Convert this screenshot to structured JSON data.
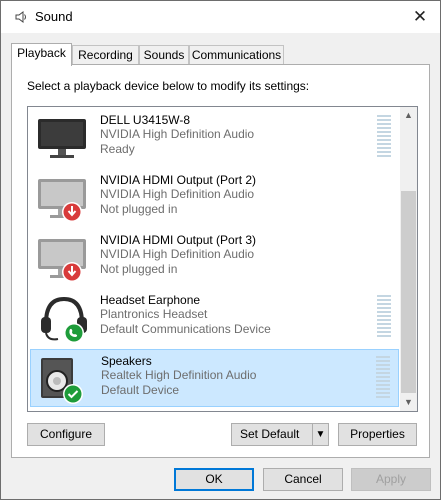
{
  "window": {
    "title": "Sound",
    "close_glyph": "✕"
  },
  "tabs": [
    {
      "label": "Playback",
      "active": true
    },
    {
      "label": "Recording",
      "active": false
    },
    {
      "label": "Sounds",
      "active": false
    },
    {
      "label": "Communications",
      "active": false
    }
  ],
  "playback": {
    "instruction": "Select a playback device below to modify its settings:",
    "devices": [
      {
        "name": "DELL U3415W-8",
        "driver": "NVIDIA High Definition Audio",
        "status": "Ready",
        "icon": "monitor-icon",
        "badge": "none",
        "selected": false
      },
      {
        "name": "NVIDIA HDMI Output (Port 2)",
        "driver": "NVIDIA High Definition Audio",
        "status": "Not plugged in",
        "icon": "monitor-icon",
        "badge": "red-down-arrow-icon",
        "selected": false
      },
      {
        "name": "NVIDIA HDMI Output (Port 3)",
        "driver": "NVIDIA High Definition Audio",
        "status": "Not plugged in",
        "icon": "monitor-icon",
        "badge": "red-down-arrow-icon",
        "selected": false
      },
      {
        "name": "Headset Earphone",
        "driver": "Plantronics Headset",
        "status": "Default Communications Device",
        "icon": "headset-icon",
        "badge": "green-phone-icon",
        "selected": false
      },
      {
        "name": "Speakers",
        "driver": "Realtek High Definition Audio",
        "status": "Default Device",
        "icon": "speaker-icon",
        "badge": "green-check-icon",
        "selected": true
      }
    ]
  },
  "buttons": {
    "configure": "Configure",
    "set_default": "Set Default",
    "set_default_arrow": "▼",
    "properties": "Properties",
    "ok": "OK",
    "cancel": "Cancel",
    "apply": "Apply"
  },
  "scroll": {
    "up": "▲",
    "down": "▼"
  },
  "colors": {
    "selection": "#cce8ff",
    "accent": "#0078d7",
    "meter": "#c4d6e2"
  }
}
